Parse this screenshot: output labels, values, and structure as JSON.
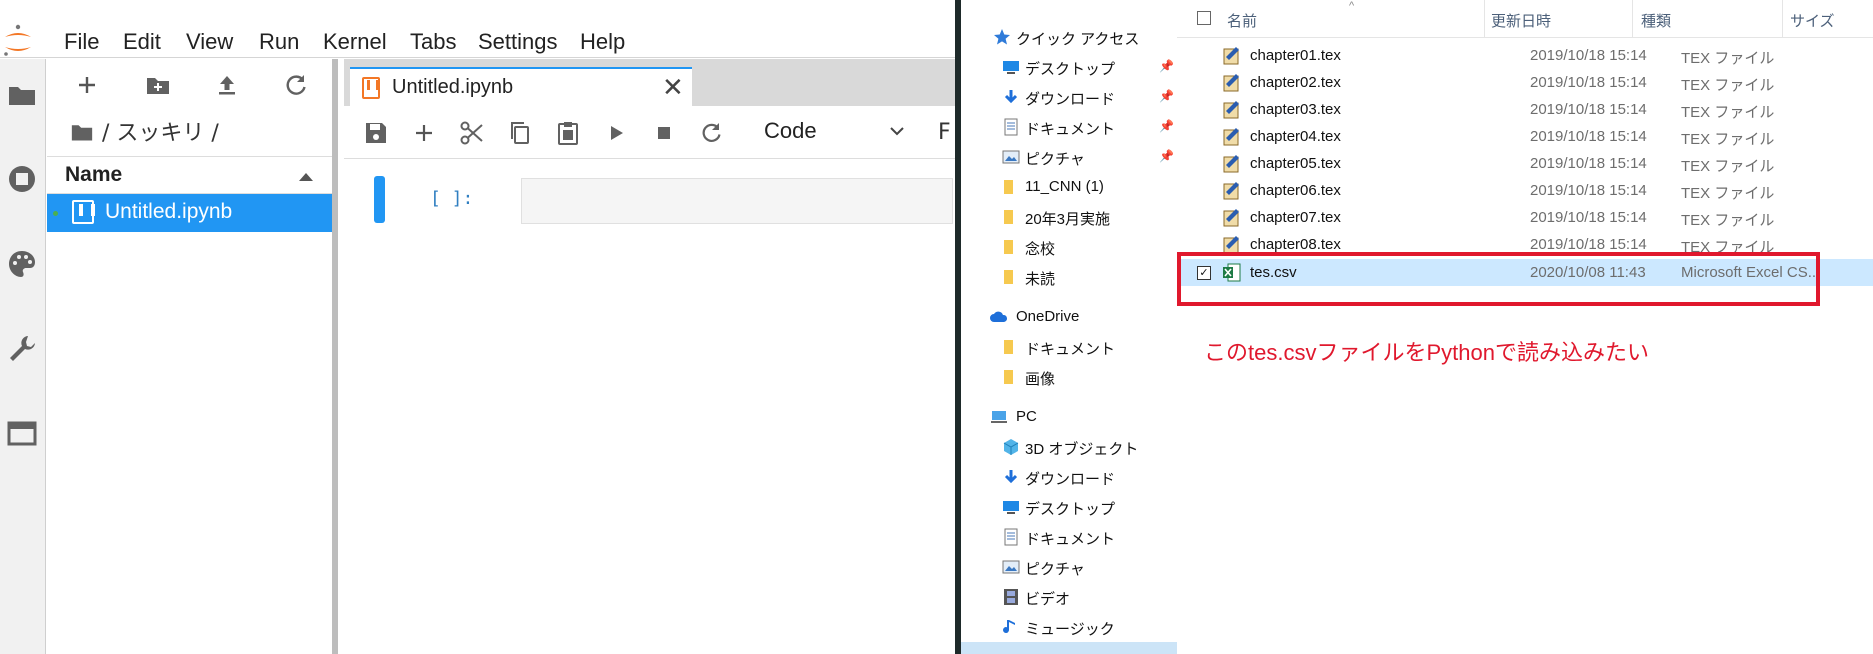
{
  "jupyter": {
    "menu": [
      "File",
      "Edit",
      "View",
      "Run",
      "Kernel",
      "Tabs",
      "Settings",
      "Help"
    ],
    "breadcrumb": "/ スッキリ /",
    "file_browser": {
      "column_name": "Name",
      "files": [
        "Untitled.ipynb"
      ]
    },
    "tab": {
      "title": "Untitled.ipynb",
      "close": "✕"
    },
    "toolbar": {
      "cell_type": "Code",
      "cut_hint": "F"
    },
    "cell": {
      "prompt": "[ ]:"
    },
    "colors": {
      "accent": "#2196f3",
      "notebook_icon": "#f37726"
    }
  },
  "explorer": {
    "nav": {
      "quick_access": "クイック アクセス",
      "quick_items": [
        "デスクトップ",
        "ダウンロード",
        "ドキュメント",
        "ピクチャ",
        "11_CNN (1)",
        "20年3月実施",
        "念校",
        "未読"
      ],
      "onedrive": "OneDrive",
      "onedrive_items": [
        "ドキュメント",
        "画像"
      ],
      "pc": "PC",
      "pc_items": [
        "3D オブジェクト",
        "ダウンロード",
        "デスクトップ",
        "ドキュメント",
        "ピクチャ",
        "ビデオ",
        "ミュージック"
      ]
    },
    "columns": {
      "name": "名前",
      "date": "更新日時",
      "type": "種類",
      "size": "サイズ"
    },
    "files": [
      {
        "name": "chapter01.tex",
        "date": "2019/10/18 15:14",
        "type": "TEX ファイル"
      },
      {
        "name": "chapter02.tex",
        "date": "2019/10/18 15:14",
        "type": "TEX ファイル"
      },
      {
        "name": "chapter03.tex",
        "date": "2019/10/18 15:14",
        "type": "TEX ファイル"
      },
      {
        "name": "chapter04.tex",
        "date": "2019/10/18 15:14",
        "type": "TEX ファイル"
      },
      {
        "name": "chapter05.tex",
        "date": "2019/10/18 15:14",
        "type": "TEX ファイル"
      },
      {
        "name": "chapter06.tex",
        "date": "2019/10/18 15:14",
        "type": "TEX ファイル"
      },
      {
        "name": "chapter07.tex",
        "date": "2019/10/18 15:14",
        "type": "TEX ファイル"
      },
      {
        "name": "chapter08.tex",
        "date": "2019/10/18 15:14",
        "type": "TEX ファイル"
      },
      {
        "name": "tes.csv",
        "date": "2020/10/08 11:43",
        "type": "Microsoft Excel CS..."
      }
    ],
    "annotation": "このtes.csvファイルをPythonで読み込みたい",
    "colors": {
      "annotation": "#e0182d",
      "selection": "#cce8ff"
    }
  }
}
